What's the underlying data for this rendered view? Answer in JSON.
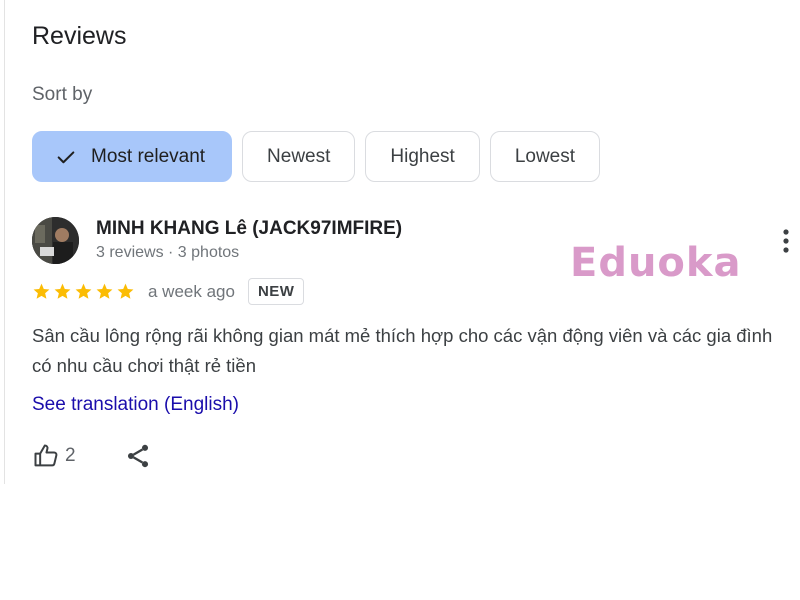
{
  "header": {
    "title": "Reviews",
    "sort_label": "Sort by"
  },
  "sort_options": [
    {
      "label": "Most relevant",
      "selected": true
    },
    {
      "label": "Newest",
      "selected": false
    },
    {
      "label": "Highest",
      "selected": false
    },
    {
      "label": "Lowest",
      "selected": false
    }
  ],
  "review": {
    "author": "MINH KHANG Lê (JACK97IMFIRE)",
    "author_meta": "3 reviews · 3 photos",
    "rating": 5,
    "time_ago": "a week ago",
    "badge": "NEW",
    "text": "Sân cầu lông rộng rãi không gian mát mẻ thích hợp cho các vận động viên và các gia đình có nhu cầu chơi thật rẻ tiền",
    "translate_link": "See translation (English)",
    "likes": "2"
  },
  "watermark": "Eduoka",
  "colors": {
    "selected_chip": "#a8c7fa",
    "star": "#fbbc04",
    "link": "#1a0dab",
    "watermark": "#d99ac9"
  },
  "icons": [
    "check-icon",
    "more-vert-icon",
    "star-icon",
    "thumb-up-icon",
    "share-icon"
  ]
}
